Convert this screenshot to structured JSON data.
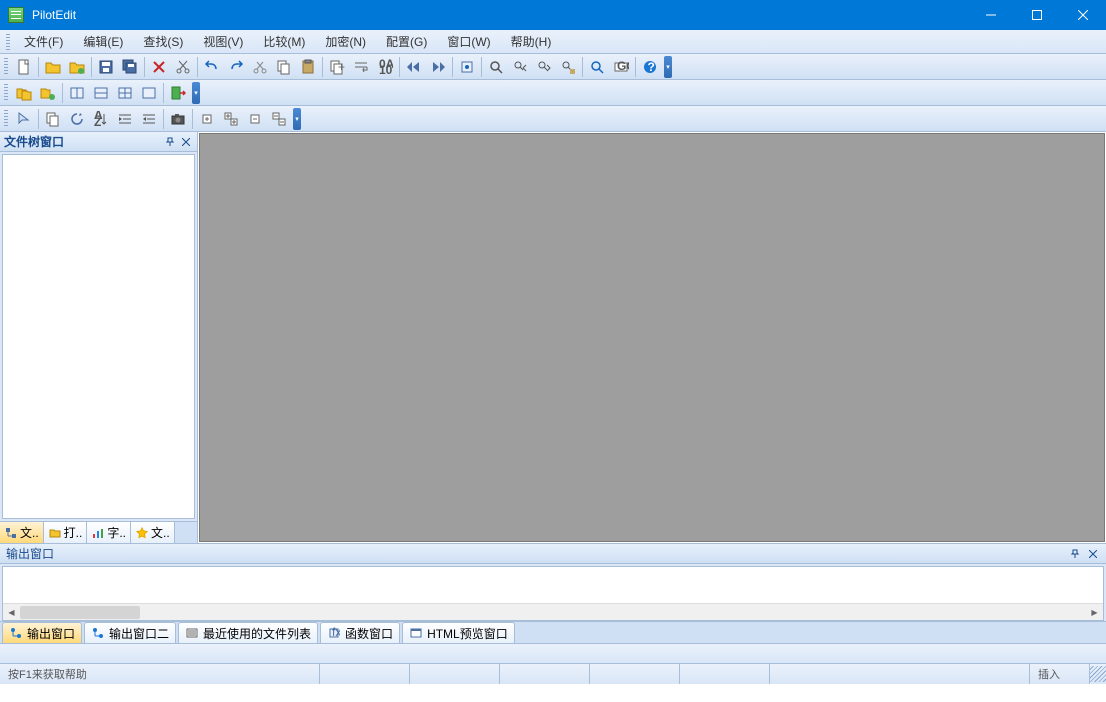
{
  "app": {
    "title": "PilotEdit"
  },
  "menu": {
    "file": "文件(F)",
    "edit": "编辑(E)",
    "find": "查找(S)",
    "view": "视图(V)",
    "compare": "比较(M)",
    "encrypt": "加密(N)",
    "config": "配置(G)",
    "window": "窗口(W)",
    "help": "帮助(H)"
  },
  "sidebar": {
    "title": "文件树窗口",
    "tabs": [
      "文..",
      "打..",
      "字..",
      "文.."
    ]
  },
  "output": {
    "title": "输出窗口",
    "tabs": [
      "输出窗口",
      "输出窗口二",
      "最近使用的文件列表",
      "函数窗口",
      "HTML预览窗口"
    ]
  },
  "status": {
    "hint": "按F1来获取帮助",
    "mode": "插入"
  }
}
